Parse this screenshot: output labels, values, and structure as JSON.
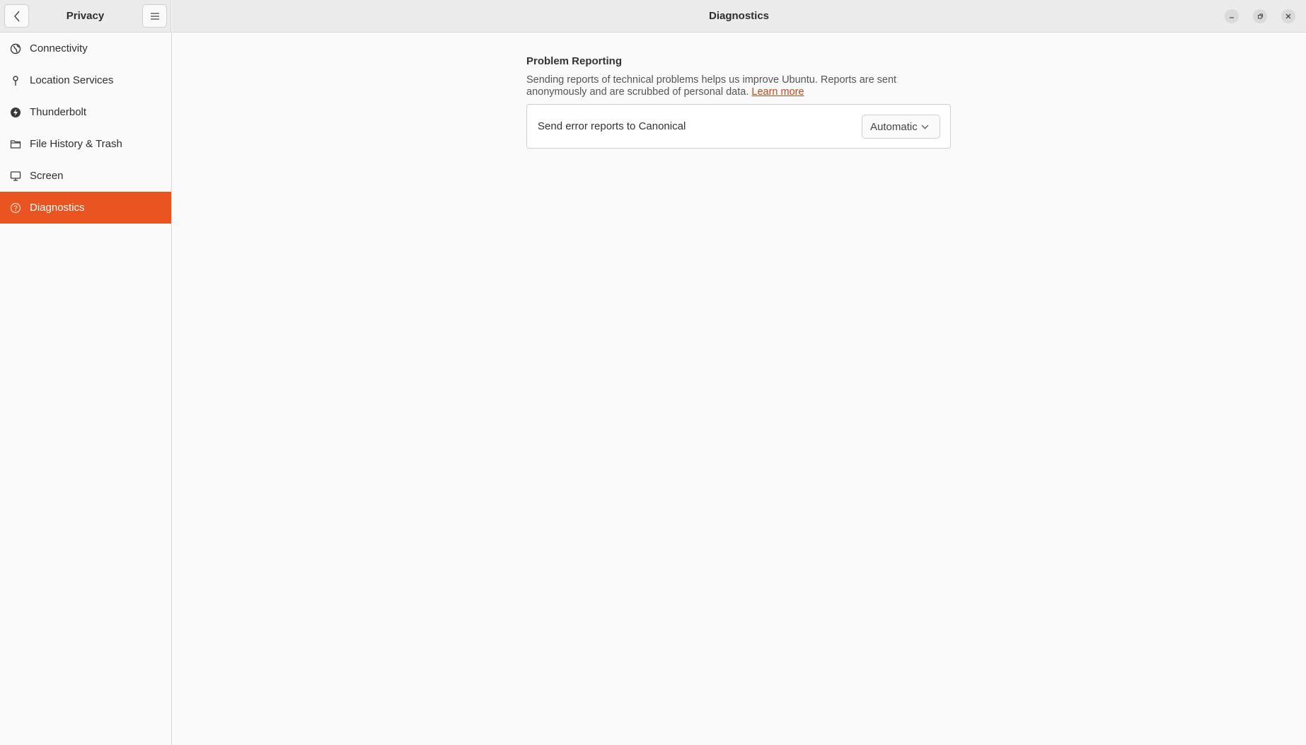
{
  "sidebar": {
    "title": "Privacy",
    "items": [
      {
        "label": "Connectivity",
        "icon": "globe-icon"
      },
      {
        "label": "Location Services",
        "icon": "location-pin-icon"
      },
      {
        "label": "Thunderbolt",
        "icon": "thunderbolt-icon"
      },
      {
        "label": "File History & Trash",
        "icon": "folder-icon"
      },
      {
        "label": "Screen",
        "icon": "monitor-icon"
      },
      {
        "label": "Diagnostics",
        "icon": "help-circle-icon",
        "active": true
      }
    ]
  },
  "header": {
    "title": "Diagnostics"
  },
  "main": {
    "section_title": "Problem Reporting",
    "description": "Sending reports of technical problems helps us improve Ubuntu. Reports are sent anonymously and are scrubbed of personal data.",
    "learn_more": "Learn more",
    "setting_label": "Send error reports to Canonical",
    "dropdown_value": "Automatic"
  },
  "colors": {
    "accent": "#e95420",
    "link": "#c7471a"
  }
}
